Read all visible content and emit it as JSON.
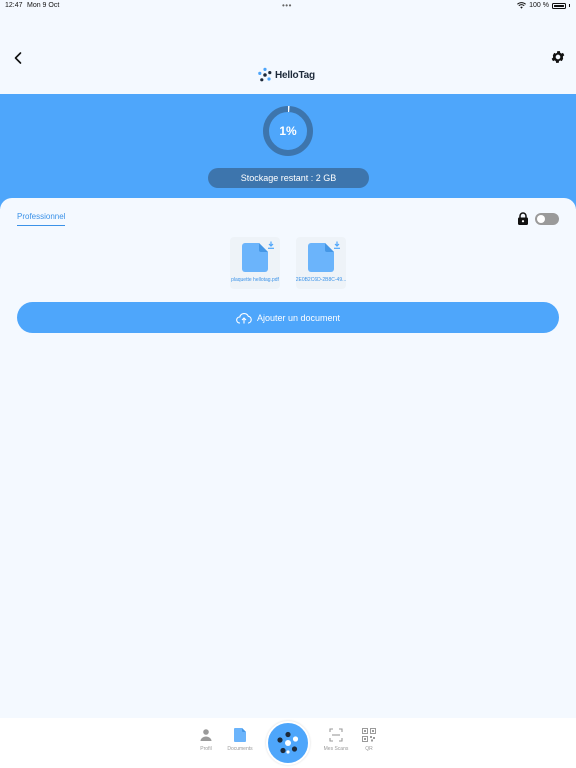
{
  "status_bar": {
    "time": "12:47",
    "date": "Mon 9 Oct",
    "battery": "100 %"
  },
  "header": {
    "logo_text": "HelloTag"
  },
  "banner": {
    "usage_percent": 1,
    "usage_label": "1%",
    "storage_label": "Stockage restant : 2 GB"
  },
  "tabs": [
    {
      "label": "Professionnel",
      "active": true
    }
  ],
  "privacy_toggle": {
    "on": false
  },
  "documents": [
    {
      "name": "plaquette hellotag.pdf"
    },
    {
      "name": "2E0B2C6D-2B8C-49..."
    }
  ],
  "add_button": {
    "label": "Ajouter un document"
  },
  "tabbar": {
    "items": [
      {
        "label": "Profil",
        "icon": "person-icon"
      },
      {
        "label": "Documents",
        "icon": "document-icon"
      },
      {
        "label": "Mes Scans",
        "icon": "scan-icon"
      },
      {
        "label": "QR",
        "icon": "qr-icon"
      }
    ]
  },
  "colors": {
    "primary": "#4ea6fb",
    "accent": "#3b92e8",
    "pill": "#3d75ad"
  }
}
